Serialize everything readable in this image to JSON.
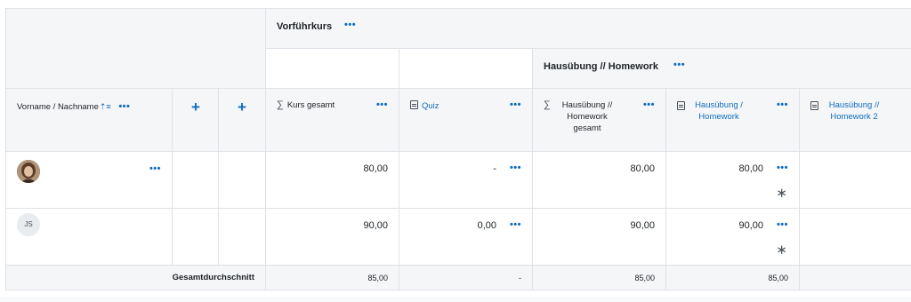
{
  "category": {
    "course_title": "Vorführkurs",
    "homework_title": "Hausübung // Homework"
  },
  "columns": {
    "name_header": "Vorname / Nachname",
    "course_total": "Kurs gesamt",
    "quiz": "Quiz",
    "homework_total": [
      "Hausübung //",
      "Homework",
      "gesamt"
    ],
    "homework1": [
      "Hausübung /",
      "Homework"
    ],
    "homework2": [
      "Hausübung //",
      "Homework 2"
    ]
  },
  "icons": {
    "more": "•••",
    "plus": "+",
    "sigma": "∑",
    "sort": "⇡≡",
    "override": "∗"
  },
  "rows": [
    {
      "avatar": "photo",
      "initials": "",
      "course_total": "80,00",
      "quiz": "-",
      "homework_total": "80,00",
      "homework1": "80,00"
    },
    {
      "avatar": "initials",
      "initials": "JS",
      "course_total": "90,00",
      "quiz": "0,00",
      "homework_total": "90,00",
      "homework1": "90,00"
    }
  ],
  "footer": {
    "label": "Gesamtdurchschnitt",
    "course_total": "85,00",
    "quiz": "-",
    "homework_total": "85,00",
    "homework1": "85,00"
  },
  "colors": {
    "link": "#0f6cbf",
    "header_bg": "#f5f6f8",
    "border": "#dee2e6"
  }
}
